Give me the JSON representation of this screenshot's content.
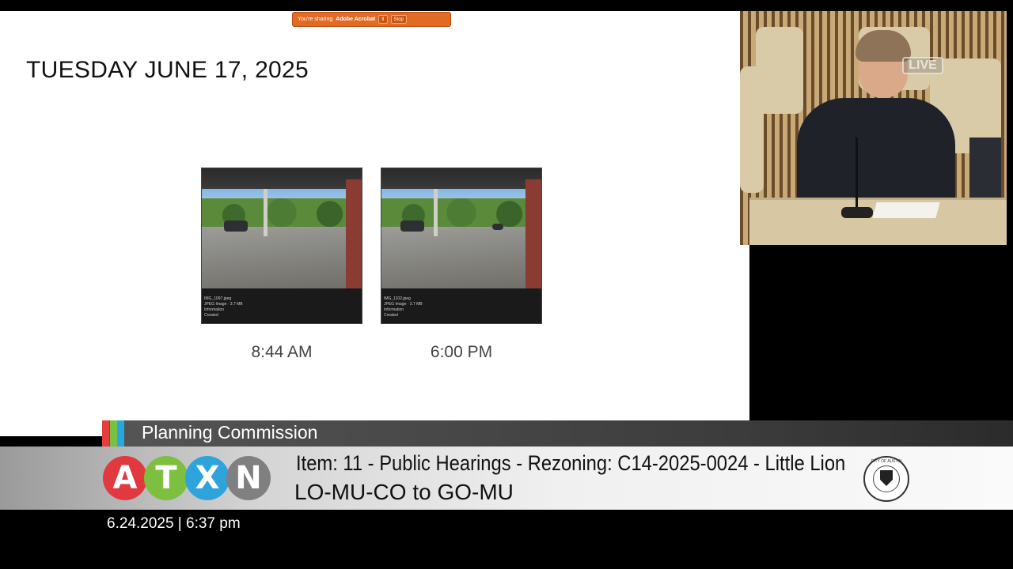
{
  "share_banner": {
    "prefix": "You're sharing",
    "app": "Adobe Acrobat",
    "pause_label": "II",
    "stop_label": "Stop"
  },
  "slide": {
    "title": "TUESDAY JUNE 17, 2025",
    "photos": [
      {
        "filename": "IMG_1097.jpeg",
        "meta": "JPEG Image · 3.7 MB",
        "info": "Information",
        "created": "Created",
        "caption": "8:44 AM"
      },
      {
        "filename": "IMG_1102.jpeg",
        "meta": "JPEG Image · 3.7 MB",
        "info": "Information",
        "created": "Created",
        "caption": "6:00 PM"
      }
    ]
  },
  "camera": {
    "live_badge": "LIVE"
  },
  "lower_third": {
    "meeting": "Planning Commission",
    "item": "Item: 11 - Public Hearings - Rezoning: C14-2025-0024 - Little Lion",
    "subtitle": "LO-MU-CO to GO-MU",
    "datetime": "6.24.2025 | 6:37 pm",
    "logo_letters": [
      "A",
      "T",
      "X",
      "N"
    ],
    "seal_text": "CITY OF AUSTIN",
    "colors": {
      "red": "#e0393f",
      "green": "#7dbf3f",
      "blue": "#2fa3dc",
      "gray": "#808080"
    }
  }
}
